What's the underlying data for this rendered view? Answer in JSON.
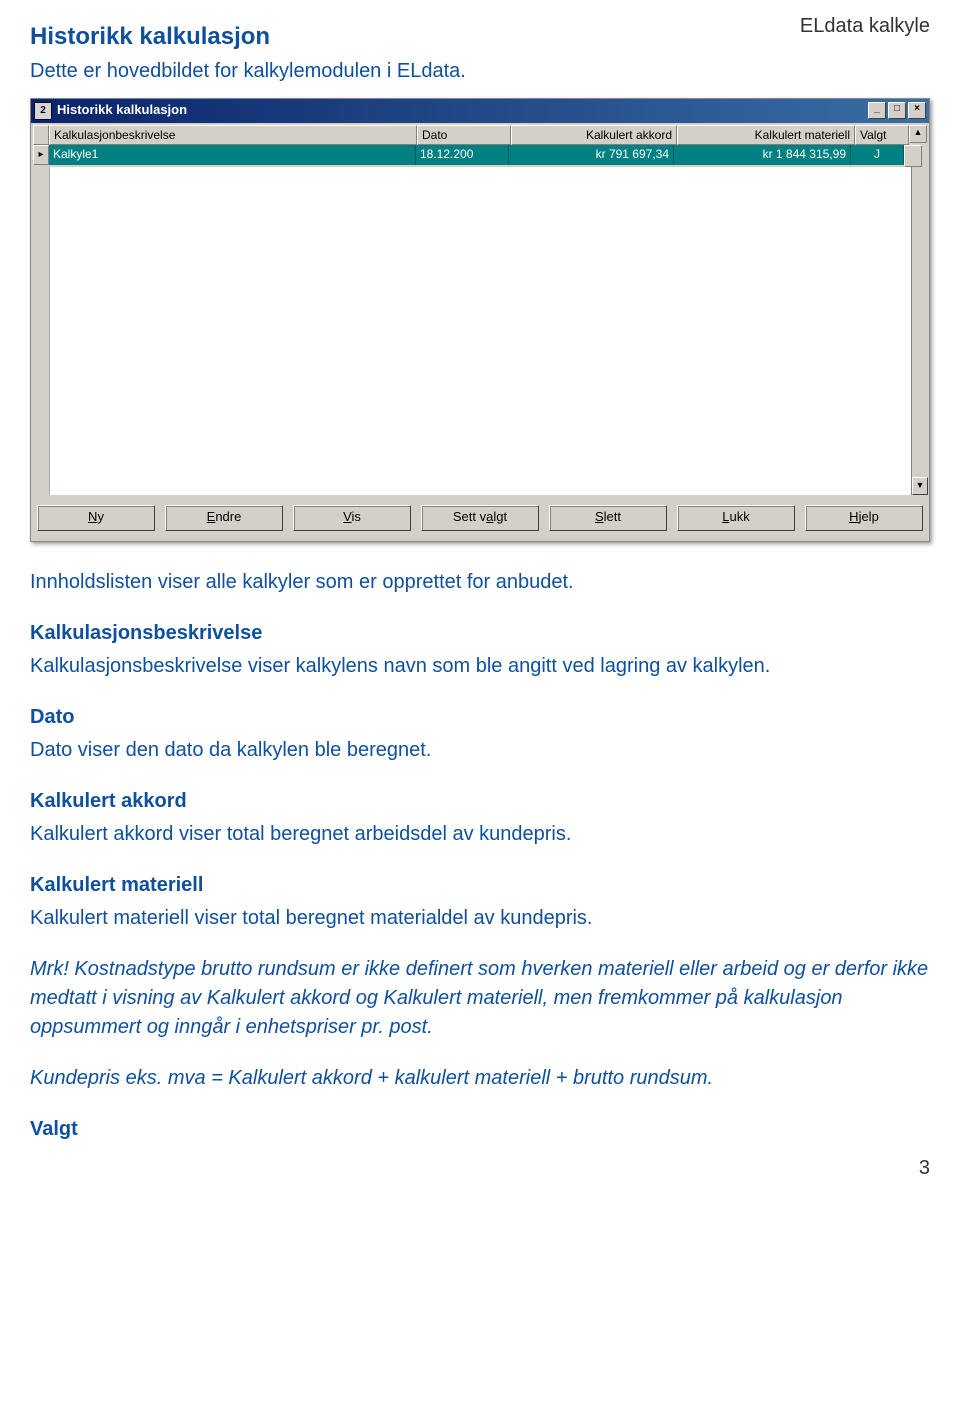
{
  "docHeaderRight": "ELdata kalkyle",
  "docTitle": "Historikk kalkulasjon",
  "docSubtitle": "Dette er hovedbildet for kalkylemodulen i ELdata.",
  "window": {
    "title": "Historikk kalkulasjon",
    "iconText": "2",
    "columns": [
      "Kalkulasjonbeskrivelse",
      "Dato",
      "Kalkulert akkord",
      "Kalkulert materiell",
      "Valgt"
    ],
    "row": {
      "beskrivelse": "Kalkyle1",
      "dato": "18.12.200",
      "akkord": "kr 791 697,34",
      "materiell": "kr 1 844 315,99",
      "valgt": "J"
    },
    "buttons": [
      "Ny",
      "Endre",
      "Vis",
      "Sett valgt",
      "Slett",
      "Lukk",
      "Hjelp"
    ]
  },
  "body": {
    "p1": "Innholdslisten viser alle kalkyler som er opprettet for anbudet.",
    "h1": "Kalkulasjonsbeskrivelse",
    "p2": "Kalkulasjonsbeskrivelse viser kalkylens navn som ble angitt ved lagring av kalkylen.",
    "h2": "Dato",
    "p3": "Dato viser den dato da kalkylen ble beregnet.",
    "h3": "Kalkulert akkord",
    "p4": "Kalkulert akkord viser total beregnet arbeidsdel av kundepris.",
    "h4": "Kalkulert materiell",
    "p5": "Kalkulert materiell viser total beregnet materialdel av kundepris.",
    "p6": "Mrk! Kostnadstype brutto rundsum er ikke definert som hverken materiell eller arbeid og er derfor ikke medtatt i visning av Kalkulert akkord og Kalkulert materiell, men fremkommer på kalkulasjon oppsummert og inngår i enhetspriser pr. post.",
    "p7": "Kundepris eks. mva = Kalkulert akkord + kalkulert materiell + brutto rundsum.",
    "h5": "Valgt"
  },
  "pageNumber": "3"
}
